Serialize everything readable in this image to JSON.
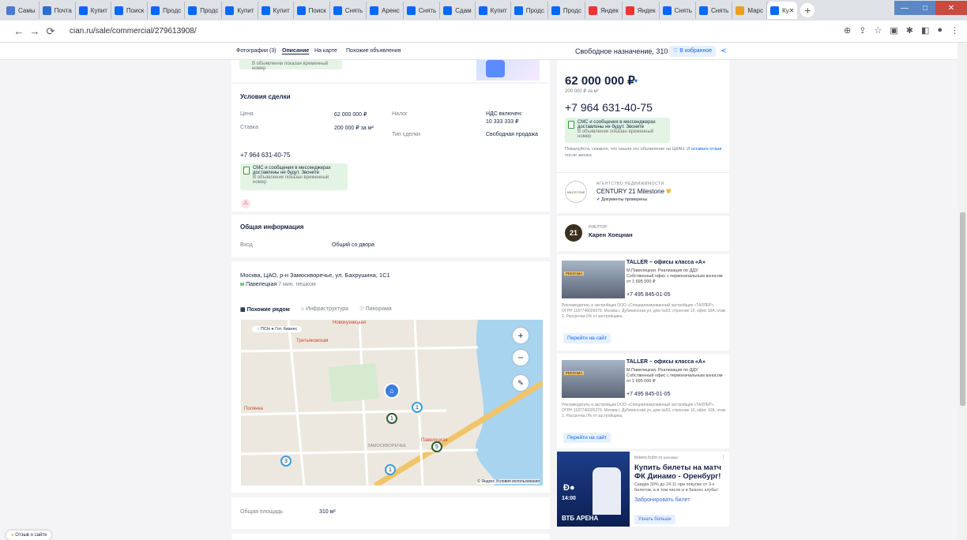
{
  "browser": {
    "tabs": [
      {
        "label": "Самы",
        "color": "#4a7bd0"
      },
      {
        "label": "Почта",
        "color": "#2a6fd0"
      },
      {
        "label": "Купит",
        "color": "#0468ff"
      },
      {
        "label": "Поиск",
        "color": "#0468ff"
      },
      {
        "label": "Продс",
        "color": "#0468ff"
      },
      {
        "label": "Продс",
        "color": "#0468ff"
      },
      {
        "label": "Купит",
        "color": "#0468ff"
      },
      {
        "label": "Купит",
        "color": "#0468ff"
      },
      {
        "label": "Поиск",
        "color": "#0468ff"
      },
      {
        "label": "Снять",
        "color": "#0468ff"
      },
      {
        "label": "Аренс",
        "color": "#0468ff"
      },
      {
        "label": "Снять",
        "color": "#0468ff"
      },
      {
        "label": "Сдам",
        "color": "#0468ff"
      },
      {
        "label": "Купит",
        "color": "#0468ff"
      },
      {
        "label": "Продс",
        "color": "#0468ff"
      },
      {
        "label": "Продс",
        "color": "#0468ff"
      },
      {
        "label": "Яндек",
        "color": "#e33"
      },
      {
        "label": "Яндек",
        "color": "#e33"
      },
      {
        "label": "Снять",
        "color": "#0468ff"
      },
      {
        "label": "Снять",
        "color": "#0468ff"
      },
      {
        "label": "Марс",
        "color": "#e8a020"
      },
      {
        "label": "Ку",
        "color": "#0468ff"
      }
    ],
    "url": "cian.ru/sale/commercial/279613908/"
  },
  "subnav": {
    "photos": "Фотографии (3)",
    "description": "Описание",
    "map": "На карте",
    "similar": "Похожие объявления",
    "title": "Свободное назначение, 310 м²",
    "favorite": "В избранное"
  },
  "top_card": {
    "temp_number": "В объявлении показан временный номер"
  },
  "deal": {
    "heading": "Условия сделки",
    "price_label": "Цена",
    "price_value": "62 000 000 ₽",
    "rate_label": "Ставка",
    "rate_value": "200 000 ₽ за м²",
    "tax_label": "Налог",
    "tax_value_1": "НДС включен:",
    "tax_value_2": "10 333 333 ₽",
    "deal_type_label": "Тип сделки",
    "deal_type_value": "Свободная продажа",
    "phone": "+7 964 631-40-75",
    "sms_1": "СМС и сообщения в мессенджерах",
    "sms_2": "доставлены не будут. Звоните",
    "sms_3": "В объявлении показан временный номер"
  },
  "general": {
    "heading": "Общая информация",
    "entrance_label": "Вход",
    "entrance_value": "Общий со двора"
  },
  "address": {
    "text": "Москва, ЦАО, р-н Замоскворечье, ул. Бахрушина, 1С1",
    "metro": "Павелецкая",
    "walk": "7 мин. пешком",
    "map_tabs": [
      "Похожие рядом",
      "Инфраструктура",
      "Панорама"
    ],
    "legend_1": "ПСН",
    "legend_2": "Гот. бизнес",
    "map_labels": [
      "Новокузнецкая",
      "Третьяковская",
      "Павелецкая",
      "ЗАМОСКВОРЕЧЬЕ",
      "Полянка"
    ],
    "map_footer": "© Яндекс Условия использования"
  },
  "area": {
    "label": "Общая площадь",
    "value": "310 м²"
  },
  "sidebar": {
    "price": "62 000 000 ₽",
    "per_m2": "200 000 ₽ за м²",
    "phone": "+7 964 631-40-75",
    "sms_1": "СМС и сообщения в мессенджерах",
    "sms_2": "доставлены не будут. Звоните",
    "sms_3": "В объявлении показан временный номер",
    "note": "Пожалуйста, скажите, что нашли это объявление на ЦИАН. И",
    "note_link": "оставьте отзыв",
    "note_tail": "после звонка",
    "agency_label": "АГЕНТСТВО НЕДВИЖИМОСТИ",
    "agency_name": "CENTURY 21 Milestone",
    "agency_docs": "Документы проверены",
    "agency_logo": "MILESTONE",
    "realtor_label": "РИЕЛТОР",
    "realtor_name": "Карен Хоецнан",
    "realtor_logo": "21"
  },
  "ads": [
    {
      "title": "TALLER – офисы класса «А»",
      "text": "М.Павелецкая. Реализация по ДДУ. Собственный офис с первоначальным взносом от 1 695 000 ₽",
      "phone": "+7 495 845-01-05",
      "legal": "Рекламодатель и застройщик ООО «Специализированный застройщик «ТАЛЛЕР», ОГРН 1187746026379. Москва г, Дубининская ул, дом №63, строение 10, офис 10А, этаж 2. Рассрочка 0% от застройщика,",
      "button": "Перейти на сайт",
      "badge": "РЕКЛАМА"
    },
    {
      "title": "TALLER – офисы класса «А»",
      "text": "М.Павелецкая. Реализация по ДДУ. Собственный офис с первоначальным взносом от 1 695 000 ₽",
      "phone": "+7 495 845-01-05",
      "legal": "Рекламодатель и застройщик ООО «Специализированный застройщик «ТАЛЛЕР», ОГРН 1187746026379. Москва г, Дубининская ул, дом №63, строение 10, офис 10А, этаж 2. Рассрочка 0% от застройщика,",
      "button": "Перейти на сайт",
      "badge": "РЕКЛАМА"
    }
  ],
  "dynamo_ad": {
    "domain": "tickets.fcdm.ru",
    "domain_tag": "реклама",
    "title": "Купить билеты на матч ФК Динамо - Оренбург!",
    "text": "Скидка 30% до 24.11 при покупке от 3-х билетов, а в том числе и в Бизнес клубы!",
    "link": "Забронировать билет",
    "button": "Узнать больше",
    "arena": "ВТБ АРЕНА",
    "time": "14:00"
  },
  "feedback": "Отзыв о сайте"
}
